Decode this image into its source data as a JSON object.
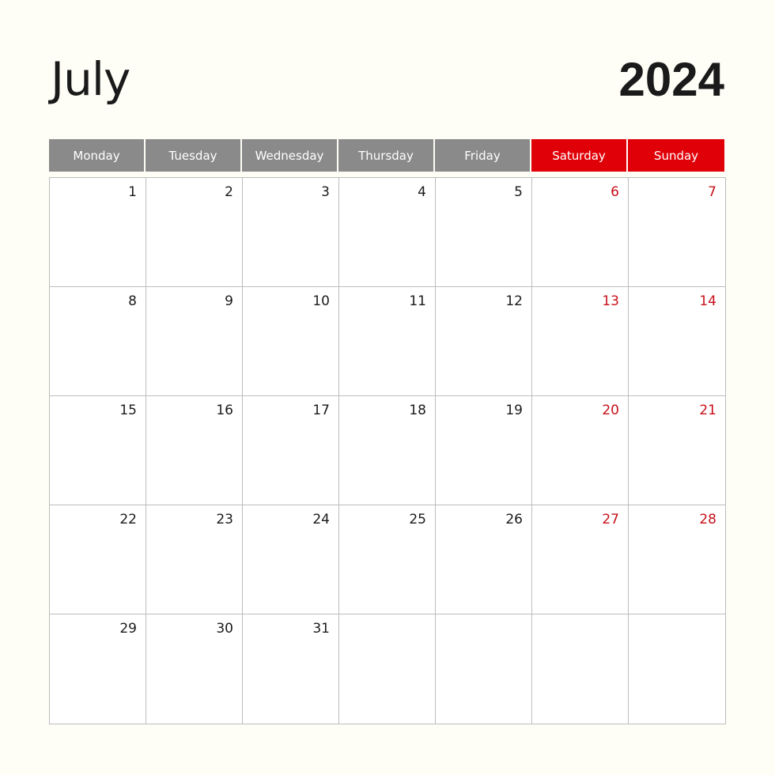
{
  "calendar": {
    "month": "July",
    "year": "2024",
    "weekdays": [
      {
        "label": "Monday",
        "weekend": false
      },
      {
        "label": "Tuesday",
        "weekend": false
      },
      {
        "label": "Wednesday",
        "weekend": false
      },
      {
        "label": "Thursday",
        "weekend": false
      },
      {
        "label": "Friday",
        "weekend": false
      },
      {
        "label": "Saturday",
        "weekend": true
      },
      {
        "label": "Sunday",
        "weekend": true
      }
    ],
    "weeks": [
      [
        "1",
        "2",
        "3",
        "4",
        "5",
        "6",
        "7"
      ],
      [
        "8",
        "9",
        "10",
        "11",
        "12",
        "13",
        "14"
      ],
      [
        "15",
        "16",
        "17",
        "18",
        "19",
        "20",
        "21"
      ],
      [
        "22",
        "23",
        "24",
        "25",
        "26",
        "27",
        "28"
      ],
      [
        "29",
        "30",
        "31",
        "",
        "",
        "",
        ""
      ]
    ],
    "colors": {
      "weekday_header": "#8a8a8a",
      "weekend_header": "#e00008",
      "weekend_number": "#c8101a"
    }
  }
}
